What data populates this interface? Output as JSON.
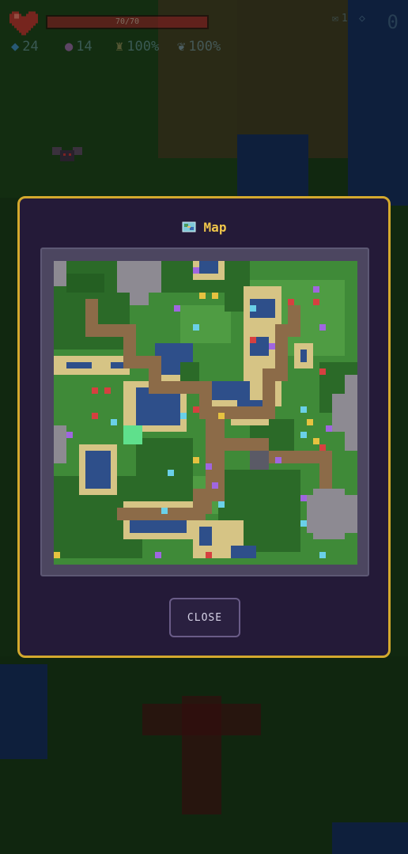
{
  "hud": {
    "hp_text": "70/70",
    "hp_fraction": 1.0,
    "gems": "24",
    "souls": "14",
    "stat_a": "100%",
    "stat_b": "100%",
    "key_count": "1",
    "score": "0",
    "icons": [
      "heart-icon",
      "gem-icon",
      "soul-icon",
      "trophy-icon",
      "wing-icon",
      "key-icon",
      "diamond-icon"
    ]
  },
  "modal": {
    "title": "Map",
    "title_icon": "map-icon",
    "close_label": "CLOSE"
  },
  "colors": {
    "modal_border": "#d4a92e",
    "modal_bg": "#241a38",
    "title": "#f0c64a",
    "grass": "#3f8a38",
    "grass_light": "#4f9c43",
    "forest": "#2b6a28",
    "water": "#2e4f8a",
    "sand": "#d6c485",
    "path": "#8c6b48",
    "rock": "#8d8a92",
    "player": "#5fe08c"
  },
  "markers": {
    "red_enemies": 10,
    "purple_items": 12,
    "cyan_items": 11,
    "yellow_items": 7
  }
}
